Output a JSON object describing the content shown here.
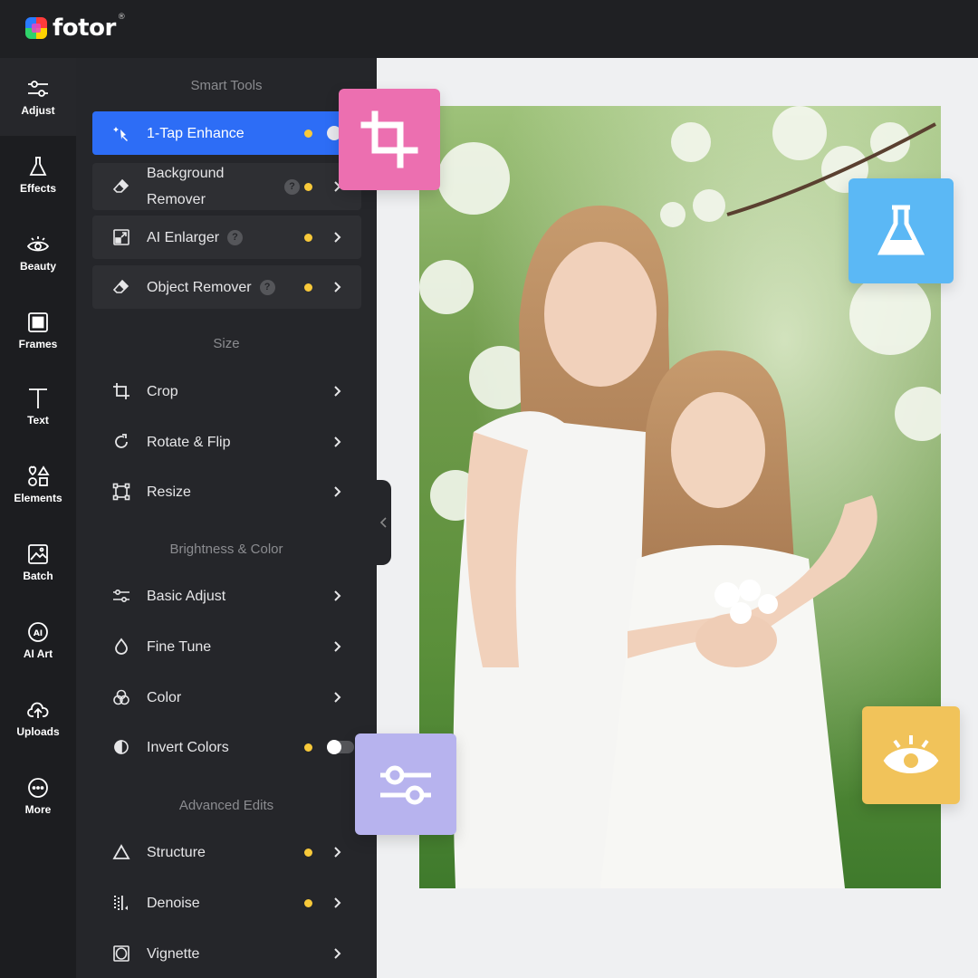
{
  "app": {
    "logo_text": "fotor",
    "logo_reg": "®"
  },
  "rail": {
    "items": [
      {
        "label": "Adjust",
        "icon": "sliders-icon"
      },
      {
        "label": "Effects",
        "icon": "flask-icon"
      },
      {
        "label": "Beauty",
        "icon": "eye-icon"
      },
      {
        "label": "Frames",
        "icon": "frame-icon"
      },
      {
        "label": "Text",
        "icon": "text-icon"
      },
      {
        "label": "Elements",
        "icon": "shapes-icon"
      },
      {
        "label": "Batch",
        "icon": "batch-image-icon"
      },
      {
        "label": "AI Art",
        "icon": "ai-icon"
      },
      {
        "label": "Uploads",
        "icon": "cloud-upload-icon"
      },
      {
        "label": "More",
        "icon": "more-icon"
      }
    ]
  },
  "panel": {
    "sections": {
      "smart": "Smart Tools",
      "size": "Size",
      "brightness": "Brightness & Color",
      "advanced": "Advanced Edits"
    },
    "tools": {
      "enhance": "1-Tap Enhance",
      "bg_remover_1": "Background",
      "bg_remover_2": "Remover",
      "ai_enlarger": "AI Enlarger",
      "object_remover": "Object Remover",
      "crop": "Crop",
      "rotate": "Rotate & Flip",
      "resize": "Resize",
      "basic_adjust": "Basic Adjust",
      "fine_tune": "Fine Tune",
      "color": "Color",
      "invert": "Invert Colors",
      "structure": "Structure",
      "denoise": "Denoise",
      "vignette": "Vignette"
    },
    "help_glyph": "?"
  },
  "colors": {
    "accent": "#2d6df6",
    "dot": "#f8c93a",
    "badge_crop": "#ec6fb0",
    "badge_effects": "#5bb8f5",
    "badge_adjust": "#b7b3ee",
    "badge_beauty": "#f1c35a"
  }
}
